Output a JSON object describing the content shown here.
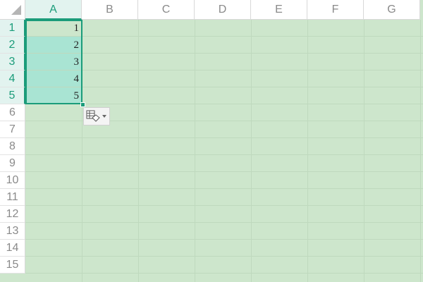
{
  "columns": [
    "A",
    "B",
    "C",
    "D",
    "E",
    "F",
    "G"
  ],
  "rows": [
    "1",
    "2",
    "3",
    "4",
    "5",
    "6",
    "7",
    "8",
    "9",
    "10",
    "11",
    "12",
    "13",
    "14",
    "15"
  ],
  "cells": {
    "A1": "1",
    "A2": "2",
    "A3": "3",
    "A4": "4",
    "A5": "5"
  },
  "selection": {
    "range": "A1:A5",
    "active_cell": "A1"
  },
  "colors": {
    "sheet_background": "#cde6cc",
    "selection_accent": "#1b9c7a",
    "selection_fill": "#a9e4d3",
    "header_background": "#ffffff",
    "header_text": "#8a8a8a"
  },
  "icons": {
    "corner": "select-all-triangle-icon",
    "paste_options": "auto-fill-options-icon",
    "paste_options_dropdown": "chevron-down-icon"
  }
}
